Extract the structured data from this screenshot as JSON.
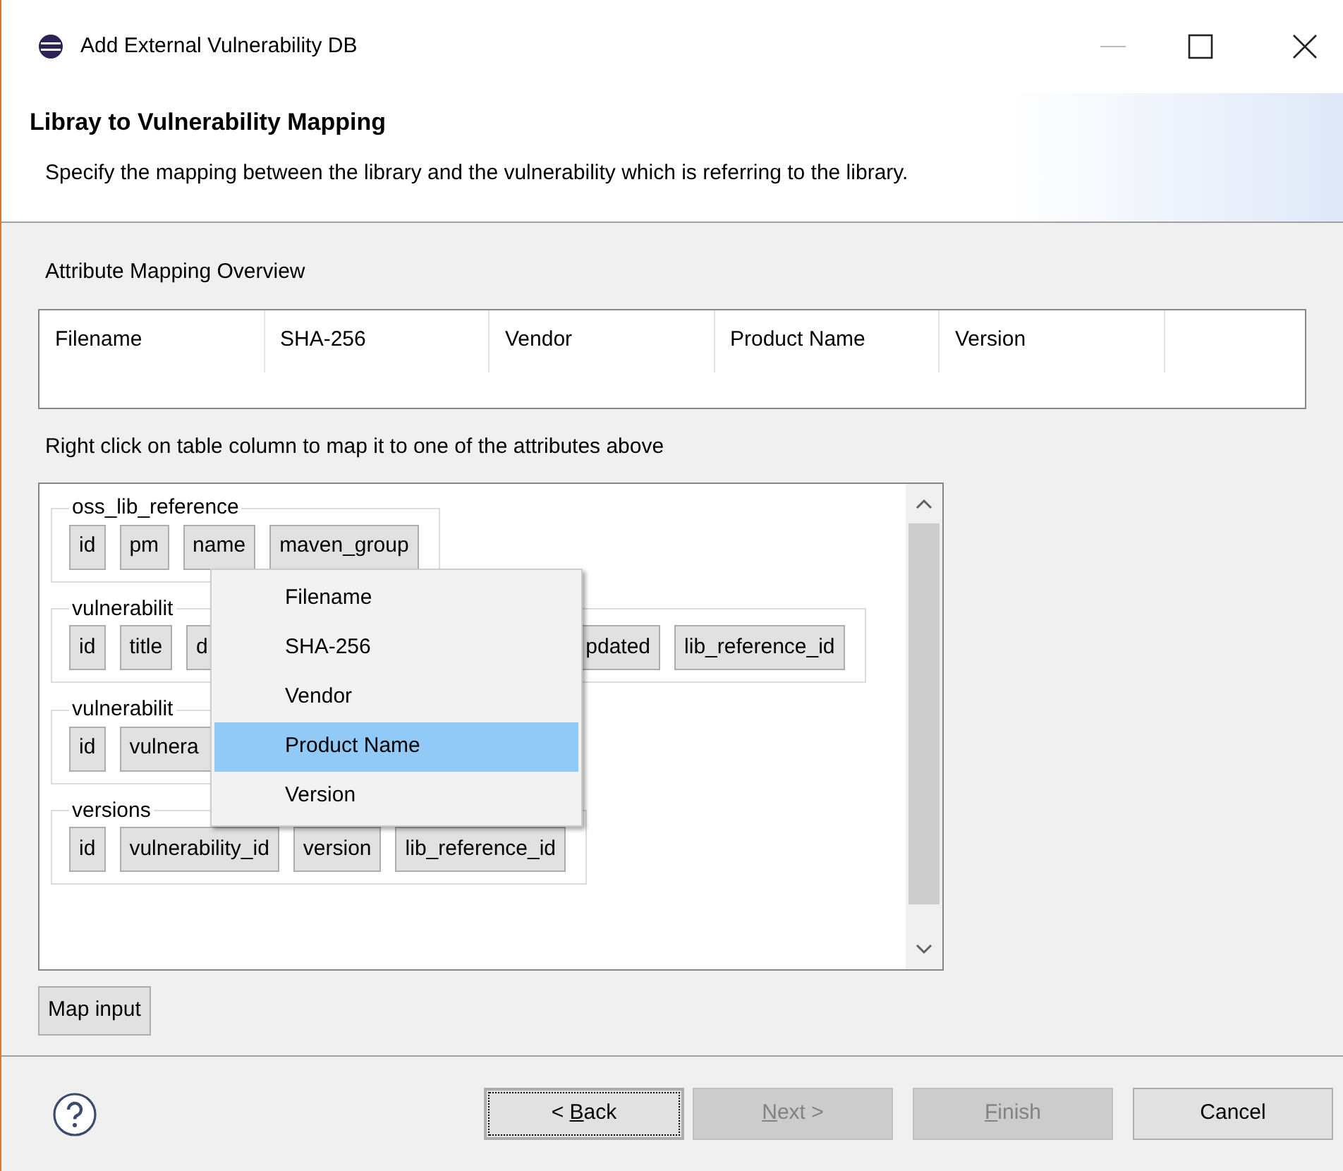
{
  "window": {
    "title": "Add External Vulnerability DB"
  },
  "header": {
    "title": "Libray to Vulnerability Mapping",
    "description": "Specify the mapping between the library and the vulnerability which is referring to the library."
  },
  "overview": {
    "label": "Attribute Mapping Overview",
    "columns": [
      "Filename",
      "SHA-256",
      "Vendor",
      "Product Name",
      "Version"
    ]
  },
  "hint": "Right click on table column to map it to one of the attributes above",
  "tables": [
    {
      "name": "oss_lib_reference",
      "columns": [
        {
          "text": "id",
          "kind": "full"
        },
        {
          "text": "pm",
          "kind": "full"
        },
        {
          "text": "name",
          "kind": "full"
        },
        {
          "text": "maven_group",
          "kind": "full"
        }
      ]
    },
    {
      "name": "vulnerabilit",
      "columns": [
        {
          "text": "id",
          "kind": "full"
        },
        {
          "text": "title",
          "kind": "full"
        },
        {
          "text": "d",
          "kind": "cut_right"
        },
        {
          "text": "pdated",
          "kind": "cut_left"
        },
        {
          "text": "lib_reference_id",
          "kind": "full"
        }
      ]
    },
    {
      "name": "vulnerabilit",
      "columns": [
        {
          "text": "id",
          "kind": "full"
        },
        {
          "text": "vulnera",
          "kind": "cut_right"
        }
      ]
    },
    {
      "name": "versions",
      "columns": [
        {
          "text": "id",
          "kind": "full"
        },
        {
          "text": "vulnerability_id",
          "kind": "full"
        },
        {
          "text": "version",
          "kind": "full"
        },
        {
          "text": "lib_reference_id",
          "kind": "full"
        }
      ]
    }
  ],
  "context_menu": [
    {
      "label": "Filename",
      "selected": false
    },
    {
      "label": "SHA-256",
      "selected": false
    },
    {
      "label": "Vendor",
      "selected": false
    },
    {
      "label": "Product Name",
      "selected": true
    },
    {
      "label": "Version",
      "selected": false
    }
  ],
  "map_button": "Map input",
  "buttons": [
    {
      "label_before": "< ",
      "mnemonic": "B",
      "label_after": "ack",
      "disabled": false,
      "focused": true
    },
    {
      "mnemonic": "N",
      "label_after": "ext >",
      "disabled": true,
      "focused": false
    },
    {
      "mnemonic": "F",
      "label_after": "inish",
      "disabled": true,
      "focused": false
    },
    {
      "label_before": "Cancel",
      "disabled": false,
      "focused": false
    }
  ]
}
